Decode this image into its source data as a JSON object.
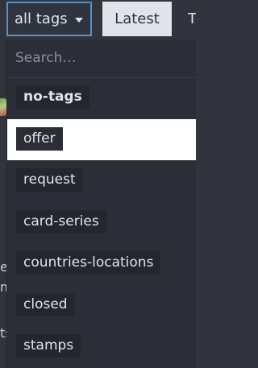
{
  "topbar": {
    "tags_select_label": "all tags",
    "tab_latest": "Latest",
    "tab_next_partial": "T"
  },
  "background_peek": {
    "line_e": "e",
    "line_m": "m",
    "line_ts": "ts"
  },
  "dropdown": {
    "search_placeholder": "Search…",
    "items": [
      {
        "label": "no-tags",
        "bold": true,
        "selected": false
      },
      {
        "label": "offer",
        "bold": false,
        "selected": true
      },
      {
        "label": "request",
        "bold": false,
        "selected": false
      },
      {
        "label": "card-series",
        "bold": false,
        "selected": false
      },
      {
        "label": "countries-locations",
        "bold": false,
        "selected": false
      },
      {
        "label": "closed",
        "bold": false,
        "selected": false
      },
      {
        "label": "stamps",
        "bold": false,
        "selected": false
      }
    ]
  },
  "colors": {
    "background": "#31343d",
    "dropdown_bg": "#2b2e36",
    "chip_bg": "#23262d",
    "selected_row": "#ffffff",
    "focus_border": "#5c8fc4",
    "tab_active_bg": "#dfe3ea"
  },
  "icons": {
    "caret": "chevron-down-icon"
  }
}
